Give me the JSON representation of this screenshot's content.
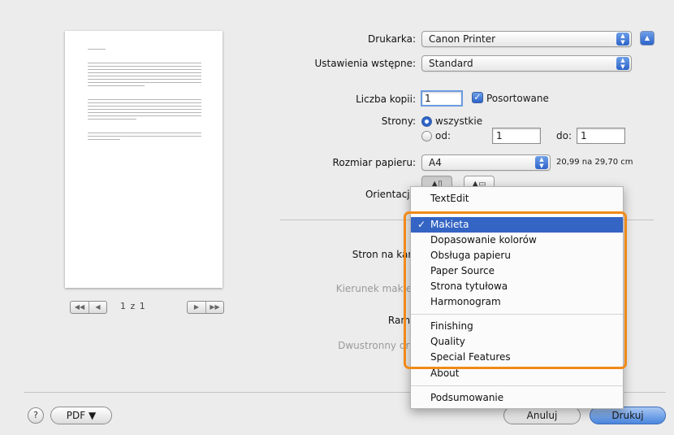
{
  "preview": {
    "page_counter": "1 z 1",
    "nav_first": "◀◀",
    "nav_prev": "◀",
    "nav_next": "▶",
    "nav_last": "▶▶"
  },
  "printer": {
    "label": "Drukarka:",
    "value": "Canon Printer"
  },
  "presets": {
    "label": "Ustawienia wstępne:",
    "value": "Standard"
  },
  "copies": {
    "label": "Liczba kopii:",
    "value": "1",
    "collated_label": "Posortowane",
    "collated_checked": true
  },
  "pages": {
    "label": "Strony:",
    "all_label": "wszystkie",
    "from_label": "od:",
    "from_value": "1",
    "to_label": "do:",
    "to_value": "1"
  },
  "paper_size": {
    "label": "Rozmiar papieru:",
    "value": "A4",
    "dimensions": "20,99 na 29,70 cm"
  },
  "orientation": {
    "label": "Orientacja"
  },
  "layout_labels": {
    "pages_per_sheet": "Stron na kart",
    "layout_direction": "Kierunek makiet",
    "border": "Ramk",
    "two_sided": "Dwustronny dru"
  },
  "dropdown_menu": {
    "items": [
      {
        "label": "TextEdit",
        "selected": false
      },
      {
        "label": "Makieta",
        "selected": true
      },
      {
        "label": "Dopasowanie kolorów",
        "selected": false
      },
      {
        "label": "Obsługa papieru",
        "selected": false
      },
      {
        "label": "Paper Source",
        "selected": false
      },
      {
        "label": "Strona tytułowa",
        "selected": false
      },
      {
        "label": "Harmonogram",
        "selected": false
      },
      {
        "label": "Finishing",
        "selected": false
      },
      {
        "label": "Quality",
        "selected": false
      },
      {
        "label": "Special Features",
        "selected": false
      },
      {
        "label": "About",
        "selected": false
      },
      {
        "label": "Podsumowanie",
        "selected": false
      }
    ],
    "checkmark": "✓"
  },
  "footer": {
    "help_label": "?",
    "pdf_label": "PDF ▼",
    "cancel_label": "Anuluj",
    "print_label": "Drukuj"
  },
  "colors": {
    "accent_blue": "#3464c4",
    "highlight_orange": "#f08a1a",
    "window_bg": "#ececec"
  }
}
